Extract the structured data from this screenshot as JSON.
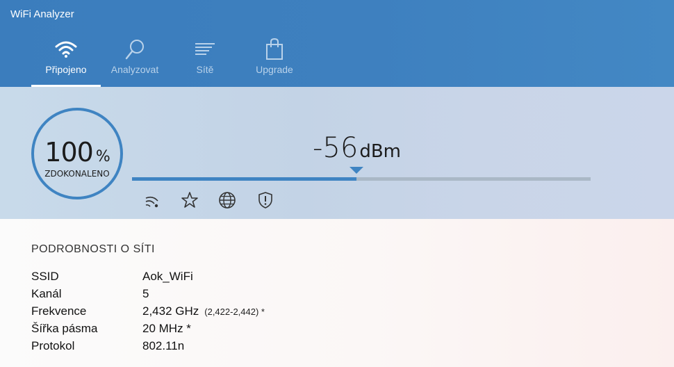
{
  "window": {
    "title": "WiFi Analyzer"
  },
  "tabs": [
    {
      "label": "Připojeno",
      "icon": "wifi-icon",
      "active": true
    },
    {
      "label": "Analyzovat",
      "icon": "magnifier-icon",
      "active": false
    },
    {
      "label": "Sítě",
      "icon": "list-icon",
      "active": false
    },
    {
      "label": "Upgrade",
      "icon": "shopping-bag-icon",
      "active": false
    }
  ],
  "signal": {
    "quality_value": "100",
    "quality_unit": "%",
    "quality_label": "ZDOKONALENO",
    "strength_value": "-56",
    "strength_unit": "dBm",
    "strength_fraction": 0.49,
    "icons": [
      "signal-icon",
      "star-icon",
      "globe-icon",
      "shield-icon"
    ]
  },
  "details": {
    "title": "PODROBNOSTI O SÍTI",
    "rows": [
      {
        "key": "SSID",
        "value": "Aok_WiFi",
        "extra": ""
      },
      {
        "key": "Kanál",
        "value": "5",
        "extra": ""
      },
      {
        "key": "Frekvence",
        "value": "2,432 GHz",
        "extra": "(2,422-2,442) *"
      },
      {
        "key": "Šířka pásma",
        "value": "20 MHz *",
        "extra": ""
      },
      {
        "key": "Protokol",
        "value": "802.11n",
        "extra": ""
      }
    ]
  },
  "colors": {
    "accent": "#3f84c2",
    "header": "#3b7dbd"
  }
}
